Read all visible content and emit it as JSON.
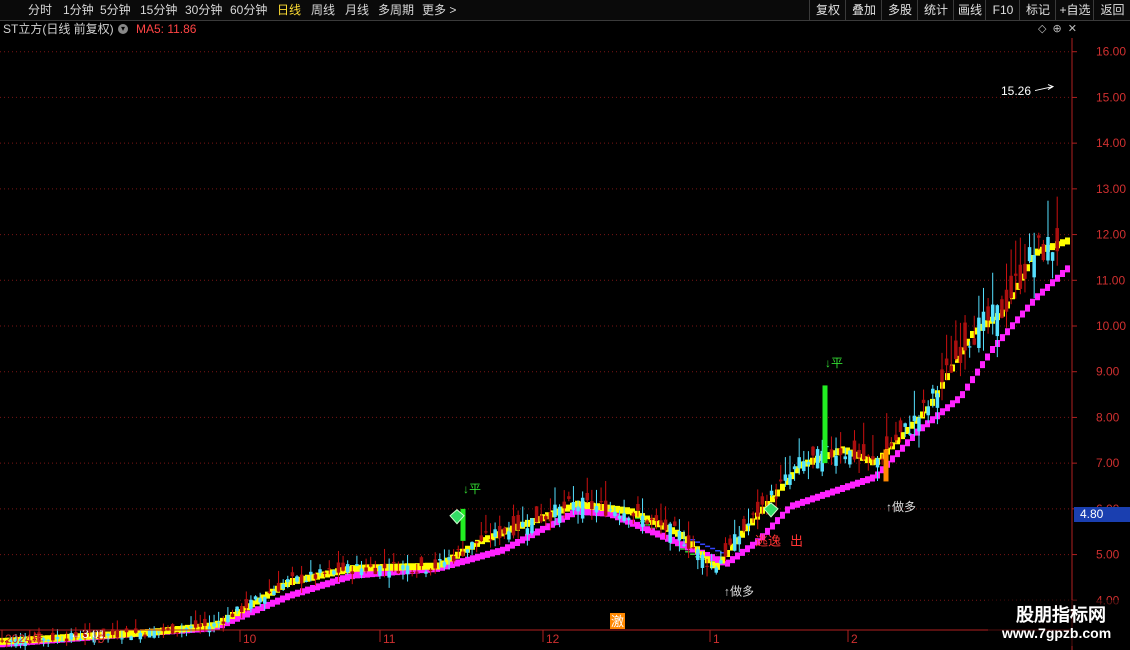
{
  "toolbar": {
    "periods": [
      "分时",
      "1分钟",
      "5分钟",
      "15分钟",
      "30分钟",
      "60分钟",
      "日线",
      "周线",
      "月线",
      "多周期",
      "更多 >"
    ],
    "active_period": "日线",
    "buttons": [
      "复权",
      "叠加",
      "多股",
      "统计",
      "画线",
      "F10",
      "标记",
      "+自选",
      "返回"
    ]
  },
  "title": {
    "stock_name": "ST立方(日线 前复权)",
    "ma_label": "MA5: 11.86"
  },
  "current_price": "4.80",
  "watermark": {
    "line1": "股朋指标网",
    "line2": "www.7gpzb.com"
  },
  "chart_data": {
    "type": "candlestick",
    "title": "ST立方(日线 前复权)",
    "y_axis": {
      "ticks": [
        "16.00",
        "15.00",
        "14.00",
        "13.00",
        "12.00",
        "11.00",
        "10.00",
        "9.00",
        "8.00",
        "7.00",
        "6.00",
        "5.00",
        "4.00"
      ],
      "range": [
        3.35,
        16.3
      ],
      "grid": true
    },
    "x_axis": {
      "labels": [
        "2024年",
        "9",
        "10",
        "11",
        "12",
        "1",
        "2"
      ]
    },
    "annotations": {
      "high": "15.26",
      "low": "←3.01",
      "sell_signal_1": "↓平",
      "sell_signal_2": "↓平",
      "buy_signal_1": "↑做多",
      "buy_signal_2": "↑做多",
      "escape": "逃逸",
      "escape_2": "出",
      "event_marker": "激"
    },
    "series": [
      {
        "name": "yellow-band",
        "color": "#ffff00",
        "type": "line"
      },
      {
        "name": "magenta-band",
        "color": "#ff22ff",
        "type": "line"
      },
      {
        "name": "green-line",
        "color": "#33cc33",
        "type": "line"
      },
      {
        "name": "blue-line",
        "color": "#3344ff",
        "type": "line"
      }
    ],
    "key_points": {
      "yellow": [
        [
          0,
          3.1
        ],
        [
          0.14,
          3.3
        ],
        [
          0.2,
          3.45
        ],
        [
          0.27,
          4.4
        ],
        [
          0.33,
          4.7
        ],
        [
          0.41,
          4.75
        ],
        [
          0.45,
          5.3
        ],
        [
          0.54,
          6.1
        ],
        [
          0.59,
          5.95
        ],
        [
          0.64,
          5.4
        ],
        [
          0.67,
          4.7
        ],
        [
          0.7,
          5.6
        ],
        [
          0.75,
          6.95
        ],
        [
          0.79,
          7.3
        ],
        [
          0.82,
          7.0
        ],
        [
          0.87,
          8.2
        ],
        [
          0.91,
          9.8
        ],
        [
          0.94,
          10.3
        ],
        [
          0.97,
          11.6
        ],
        [
          1.0,
          11.86
        ]
      ],
      "magenta": [
        [
          0,
          3.05
        ],
        [
          0.14,
          3.3
        ],
        [
          0.2,
          3.4
        ],
        [
          0.27,
          4.1
        ],
        [
          0.33,
          4.55
        ],
        [
          0.41,
          4.7
        ],
        [
          0.47,
          5.1
        ],
        [
          0.54,
          5.95
        ],
        [
          0.57,
          5.9
        ],
        [
          0.68,
          4.8
        ],
        [
          0.71,
          5.3
        ],
        [
          0.74,
          6.05
        ],
        [
          0.82,
          6.7
        ],
        [
          0.86,
          7.7
        ],
        [
          0.9,
          8.45
        ],
        [
          0.93,
          9.5
        ],
        [
          0.97,
          10.6
        ],
        [
          1.0,
          11.25
        ]
      ],
      "green": [
        [
          0.54,
          6.1
        ],
        [
          0.59,
          5.9
        ],
        [
          0.64,
          5.1
        ],
        [
          0.67,
          4.75
        ]
      ],
      "blue": [
        [
          0.54,
          6.1
        ],
        [
          0.6,
          5.9
        ],
        [
          0.65,
          5.3
        ],
        [
          0.68,
          5.0
        ]
      ]
    },
    "candles_ohlc_sample": [
      [
        3.2,
        3.35,
        3.05,
        3.25
      ],
      [
        3.25,
        3.4,
        3.1,
        3.3
      ],
      [
        3.3,
        3.5,
        3.2,
        3.4
      ],
      [
        3.4,
        4.3,
        3.35,
        4.0
      ],
      [
        4.0,
        5.1,
        3.9,
        4.6
      ],
      [
        4.6,
        5.0,
        4.3,
        4.5
      ],
      [
        4.5,
        5.2,
        4.4,
        5.0
      ],
      [
        5.0,
        6.3,
        4.9,
        5.8
      ],
      [
        5.8,
        6.5,
        5.5,
        6.0
      ],
      [
        6.0,
        6.2,
        5.4,
        5.6
      ],
      [
        5.6,
        5.7,
        4.9,
        5.0
      ],
      [
        5.0,
        5.1,
        4.3,
        4.5
      ],
      [
        4.5,
        4.8,
        4.2,
        4.4
      ],
      [
        4.4,
        5.5,
        4.3,
        5.3
      ],
      [
        5.3,
        8.7,
        5.2,
        8.3
      ],
      [
        8.3,
        9.0,
        7.6,
        8.0
      ],
      [
        8.0,
        8.2,
        6.8,
        7.0
      ],
      [
        7.0,
        7.2,
        5.8,
        6.2
      ],
      [
        6.2,
        7.3,
        6.0,
        7.1
      ],
      [
        7.1,
        10.8,
        7.0,
        10.3
      ],
      [
        10.3,
        11.2,
        9.2,
        9.6
      ],
      [
        9.6,
        10.5,
        8.8,
        10.2
      ],
      [
        10.2,
        11.6,
        9.8,
        11.3
      ],
      [
        11.3,
        13.8,
        11.0,
        12.6
      ],
      [
        12.6,
        15.26,
        12.2,
        14.3
      ],
      [
        14.3,
        14.5,
        12.8,
        13.0
      ]
    ]
  }
}
